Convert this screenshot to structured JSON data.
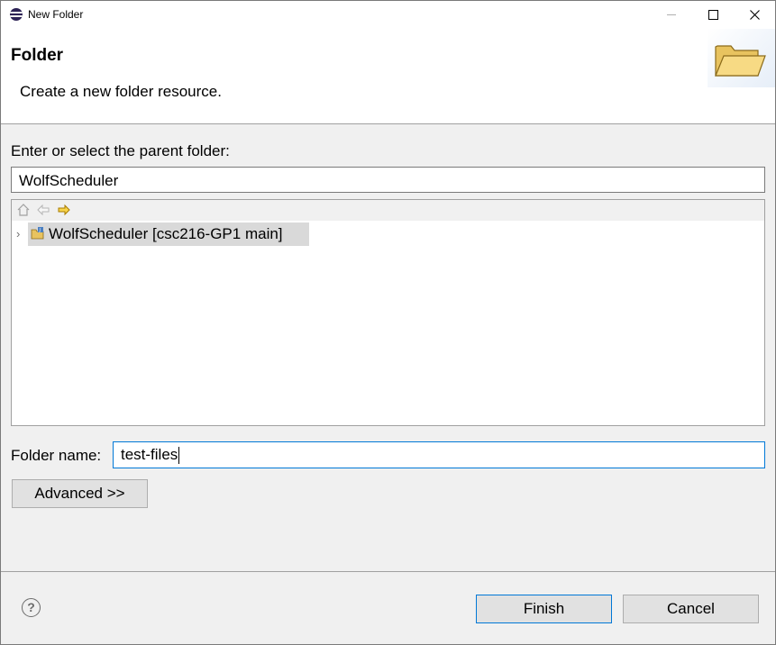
{
  "window": {
    "title": "New Folder"
  },
  "header": {
    "title": "Folder",
    "description": "Create a new folder resource."
  },
  "parent": {
    "label": "Enter or select the parent folder:",
    "value": "WolfScheduler"
  },
  "tree": {
    "toolbar_icons": [
      "home-icon",
      "back-arrow-icon",
      "forward-arrow-icon"
    ],
    "items": [
      {
        "label": "WolfScheduler [csc216-GP1 main]",
        "selected": true,
        "expanded": false
      }
    ]
  },
  "folder_name": {
    "label": "Folder name:",
    "value": "test-files"
  },
  "buttons": {
    "advanced": "Advanced >>",
    "finish": "Finish",
    "cancel": "Cancel"
  },
  "help": {
    "glyph": "?"
  },
  "colors": {
    "accent": "#0078d7",
    "selection": "#d9d9d9"
  }
}
